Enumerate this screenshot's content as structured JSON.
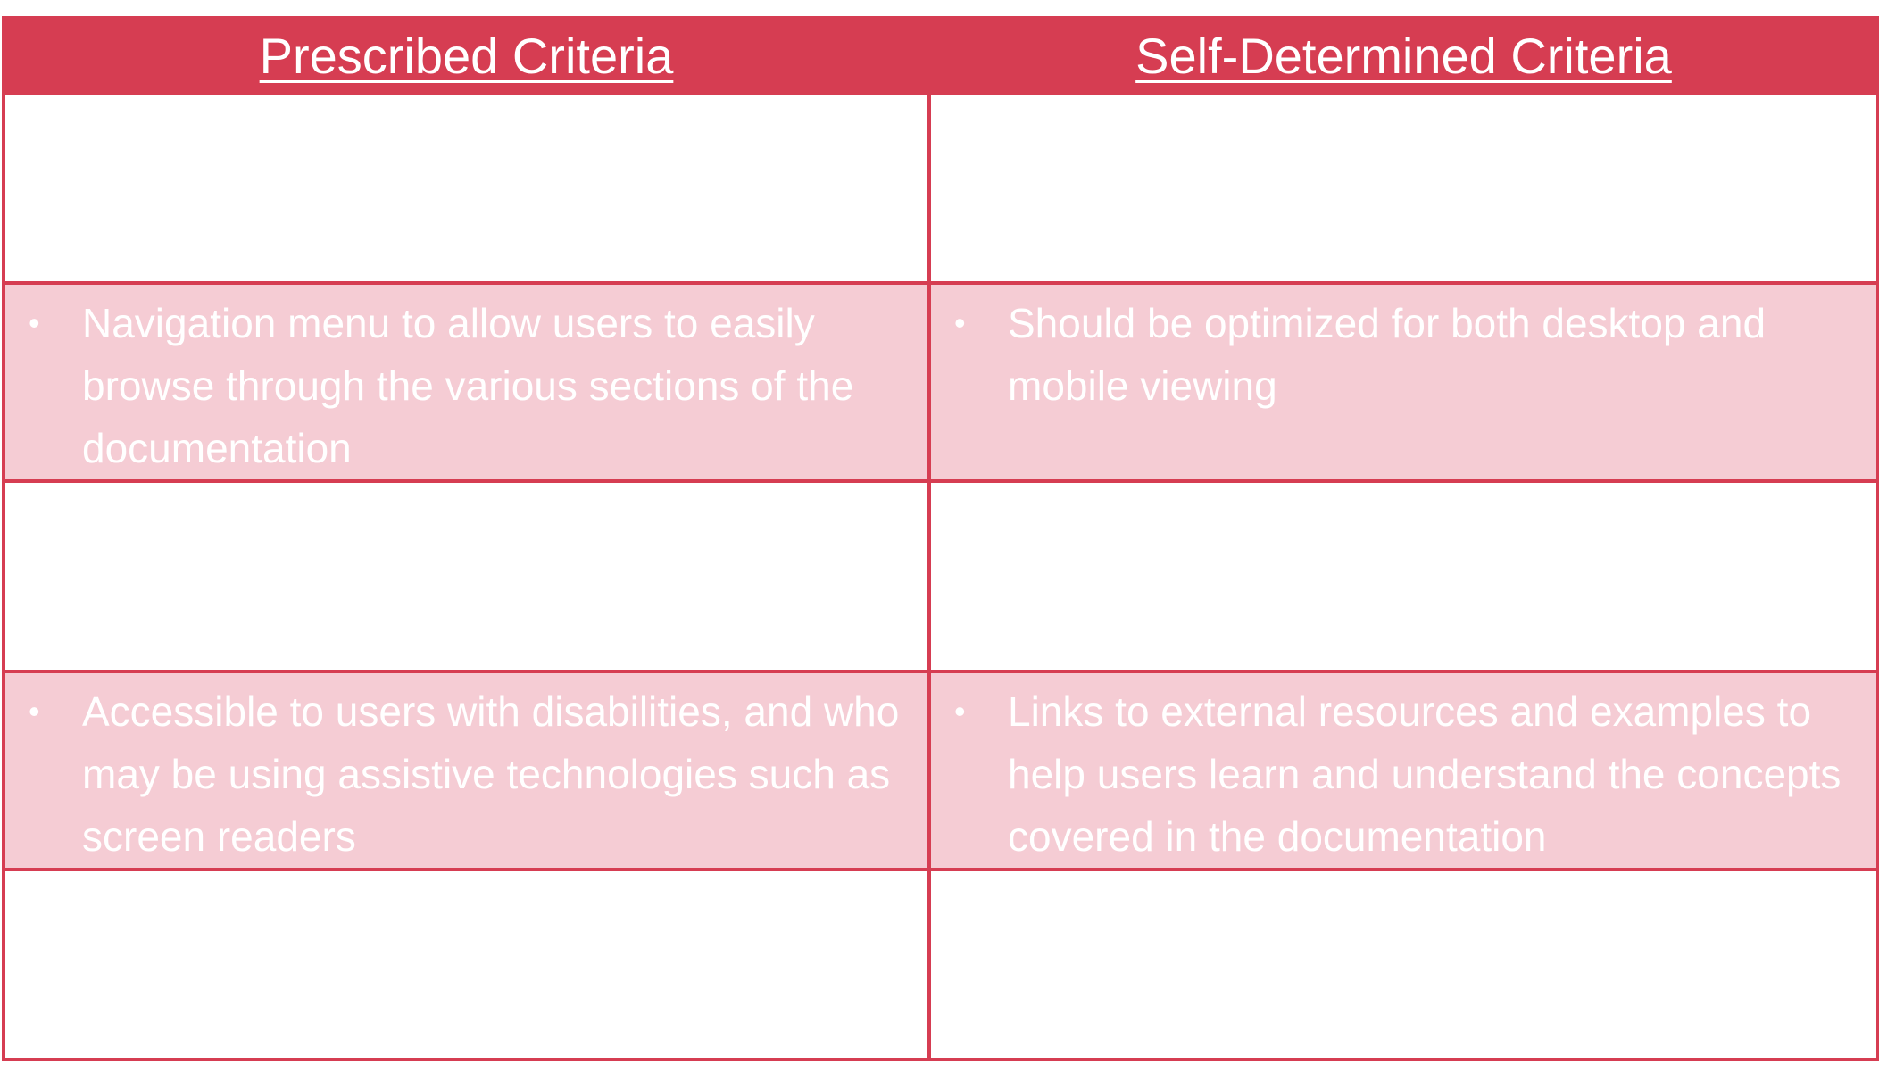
{
  "table": {
    "headers": {
      "left": "Prescribed Criteria",
      "right": "Self-Determined Criteria"
    },
    "rows": [
      {
        "style": "white",
        "left": "",
        "right": ""
      },
      {
        "style": "pink",
        "left": "Navigation menu to allow users to easily browse through the various sections of the documentation",
        "right": "Should be optimized for both desktop and mobile viewing"
      },
      {
        "style": "white",
        "left": "",
        "right": ""
      },
      {
        "style": "pink",
        "left": "Accessible to users with disabilities, and who may be using assistive technologies such as screen readers",
        "right": "Links to external resources and examples to help users learn and understand the concepts covered in the documentation"
      },
      {
        "style": "white",
        "left": "",
        "right": ""
      }
    ],
    "bullet_symbol": "•"
  },
  "colors": {
    "header": "#d63d52",
    "border": "#d63d52",
    "pink_row": "#f5ccd4",
    "white_row": "#ffffff",
    "text": "#ffffff"
  }
}
